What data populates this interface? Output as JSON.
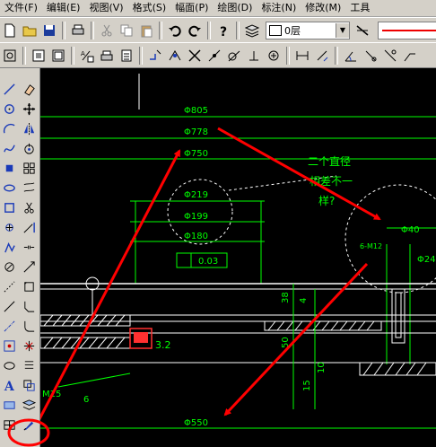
{
  "menubar": {
    "items": [
      "文件(F)",
      "编辑(E)",
      "视图(V)",
      "格式(S)",
      "幅面(P)",
      "绘图(D)",
      "标注(N)",
      "修改(M)",
      "工具"
    ]
  },
  "toolbar": {
    "layer_value": "0层"
  },
  "drawing": {
    "dims": {
      "d805": "Φ805",
      "d778": "Φ778",
      "d750": "Φ750",
      "d219": "Φ219",
      "d199": "Φ199",
      "d180": "Φ180",
      "d550": "Φ550",
      "d40": "Φ40",
      "m12": "6-M12",
      "d24": "Φ24",
      "m15": "M15",
      "v003": "0.03",
      "v32": "3.2",
      "v6": "6",
      "v38": "38",
      "v50": "50",
      "v15": "15",
      "v10": "10",
      "v4": "4"
    },
    "note_line1": "二个直径",
    "note_line2": "相差不一",
    "note_line3": "样?"
  },
  "colors": {
    "canvas_bg": "#000000",
    "cad_green": "#00ff00",
    "cad_white": "#ffffff",
    "annotation_red": "#ff0000"
  }
}
